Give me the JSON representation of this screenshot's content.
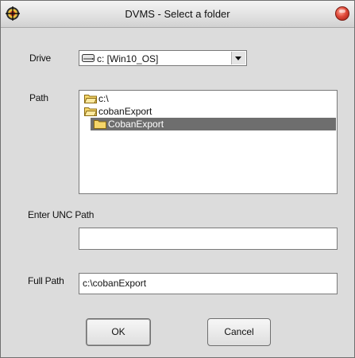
{
  "window": {
    "title": "DVMS - Select a folder"
  },
  "drive": {
    "label": "Drive",
    "selected": "c: [Win10_OS]"
  },
  "path": {
    "label": "Path",
    "tree": [
      {
        "label": "c:\\",
        "selected": false
      },
      {
        "label": "cobanExport",
        "selected": false
      },
      {
        "label": "CobanExport",
        "selected": true
      }
    ]
  },
  "unc": {
    "label": "Enter UNC Path",
    "value": "",
    "placeholder": ""
  },
  "full_path": {
    "label": "Full Path",
    "value": "c:\\cobanExport"
  },
  "buttons": {
    "ok": "OK",
    "cancel": "Cancel"
  },
  "colors": {
    "window_bg": "#dcdcdc",
    "selection_bg": "#6e6e6e",
    "folder_yellow": "#f5d66a",
    "close_red": "#e04a3a"
  }
}
